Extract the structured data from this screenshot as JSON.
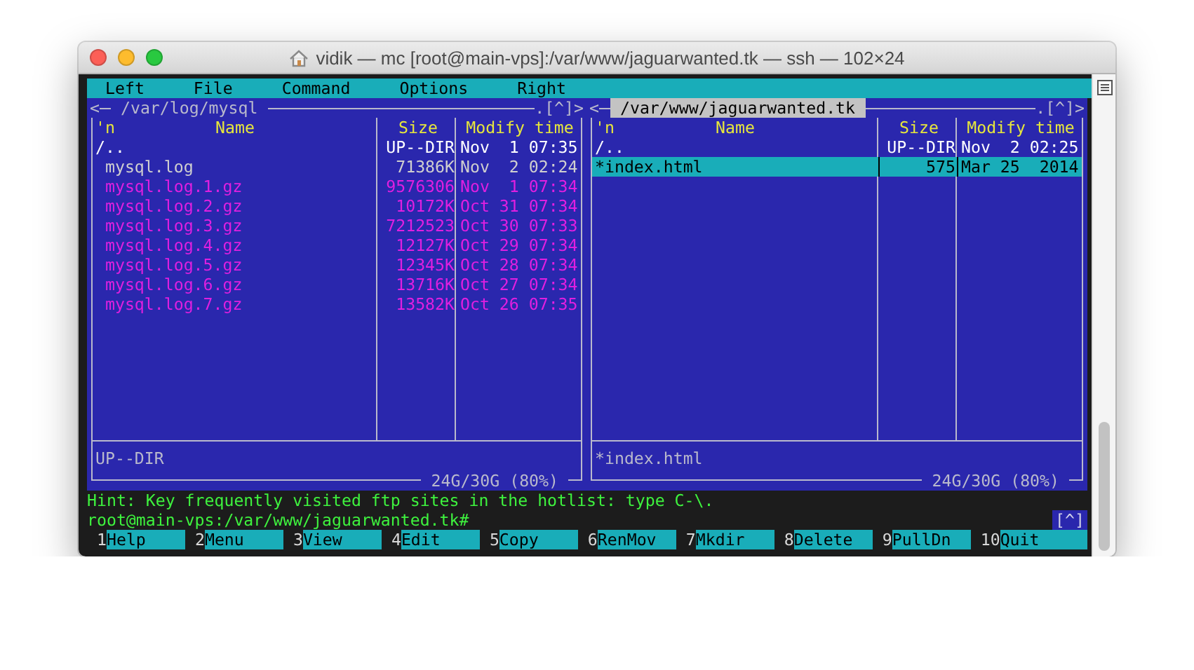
{
  "window": {
    "title": "vidik — mc [root@main-vps]:/var/www/jaguarwanted.tk — ssh — 102×24"
  },
  "menu": [
    "Left",
    "File",
    "Command",
    "Options",
    "Right"
  ],
  "panels": [
    {
      "active": false,
      "history_button": "<",
      "path": "/var/log/mysql",
      "controls": ".[^]>",
      "sort_indicator": "'n",
      "columns": [
        "Name",
        "Size",
        "Modify time"
      ],
      "rows": [
        {
          "name": "/..",
          "size": "UP--DIR",
          "modified": "Nov  1 07:35",
          "kind": "dir",
          "selected": false
        },
        {
          "name": " mysql.log",
          "size": "71386K",
          "modified": "Nov  2 02:24",
          "kind": "file",
          "selected": false
        },
        {
          "name": " mysql.log.1.gz",
          "size": "9576306",
          "modified": "Nov  1 07:34",
          "kind": "archive",
          "selected": false
        },
        {
          "name": " mysql.log.2.gz",
          "size": "10172K",
          "modified": "Oct 31 07:34",
          "kind": "archive",
          "selected": false
        },
        {
          "name": " mysql.log.3.gz",
          "size": "7212523",
          "modified": "Oct 30 07:33",
          "kind": "archive",
          "selected": false
        },
        {
          "name": " mysql.log.4.gz",
          "size": "12127K",
          "modified": "Oct 29 07:34",
          "kind": "archive",
          "selected": false
        },
        {
          "name": " mysql.log.5.gz",
          "size": "12345K",
          "modified": "Oct 28 07:34",
          "kind": "archive",
          "selected": false
        },
        {
          "name": " mysql.log.6.gz",
          "size": "13716K",
          "modified": "Oct 27 07:34",
          "kind": "archive",
          "selected": false
        },
        {
          "name": " mysql.log.7.gz",
          "size": "13582K",
          "modified": "Oct 26 07:35",
          "kind": "archive",
          "selected": false
        }
      ],
      "status": "UP--DIR",
      "free_space": "24G/30G (80%)"
    },
    {
      "active": true,
      "history_button": "<",
      "path": "/var/www/jaguarwanted.tk",
      "controls": ".[^]>",
      "sort_indicator": "'n",
      "columns": [
        "Name",
        "Size",
        "Modify time"
      ],
      "rows": [
        {
          "name": "/..",
          "size": "UP--DIR",
          "modified": "Nov  2 02:25",
          "kind": "dir",
          "selected": false
        },
        {
          "name": "*index.html",
          "size": "575",
          "modified": "Mar 25  2014",
          "kind": "file",
          "selected": true
        }
      ],
      "status": "*index.html",
      "free_space": "24G/30G (80%)"
    }
  ],
  "hint": "Hint: Key frequently visited ftp sites in the hotlist: type C-\\.",
  "prompt": "root@main-vps:/var/www/jaguarwanted.tk#",
  "prompt_indicator": "[^]",
  "function_keys": [
    {
      "number": "1",
      "label": "Help"
    },
    {
      "number": "2",
      "label": "Menu"
    },
    {
      "number": "3",
      "label": "View"
    },
    {
      "number": "4",
      "label": "Edit"
    },
    {
      "number": "5",
      "label": "Copy"
    },
    {
      "number": "6",
      "label": "RenMov"
    },
    {
      "number": "7",
      "label": "Mkdir"
    },
    {
      "number": "8",
      "label": "Delete"
    },
    {
      "number": "9",
      "label": "PullDn"
    },
    {
      "number": "10",
      "label": "Quit"
    }
  ]
}
